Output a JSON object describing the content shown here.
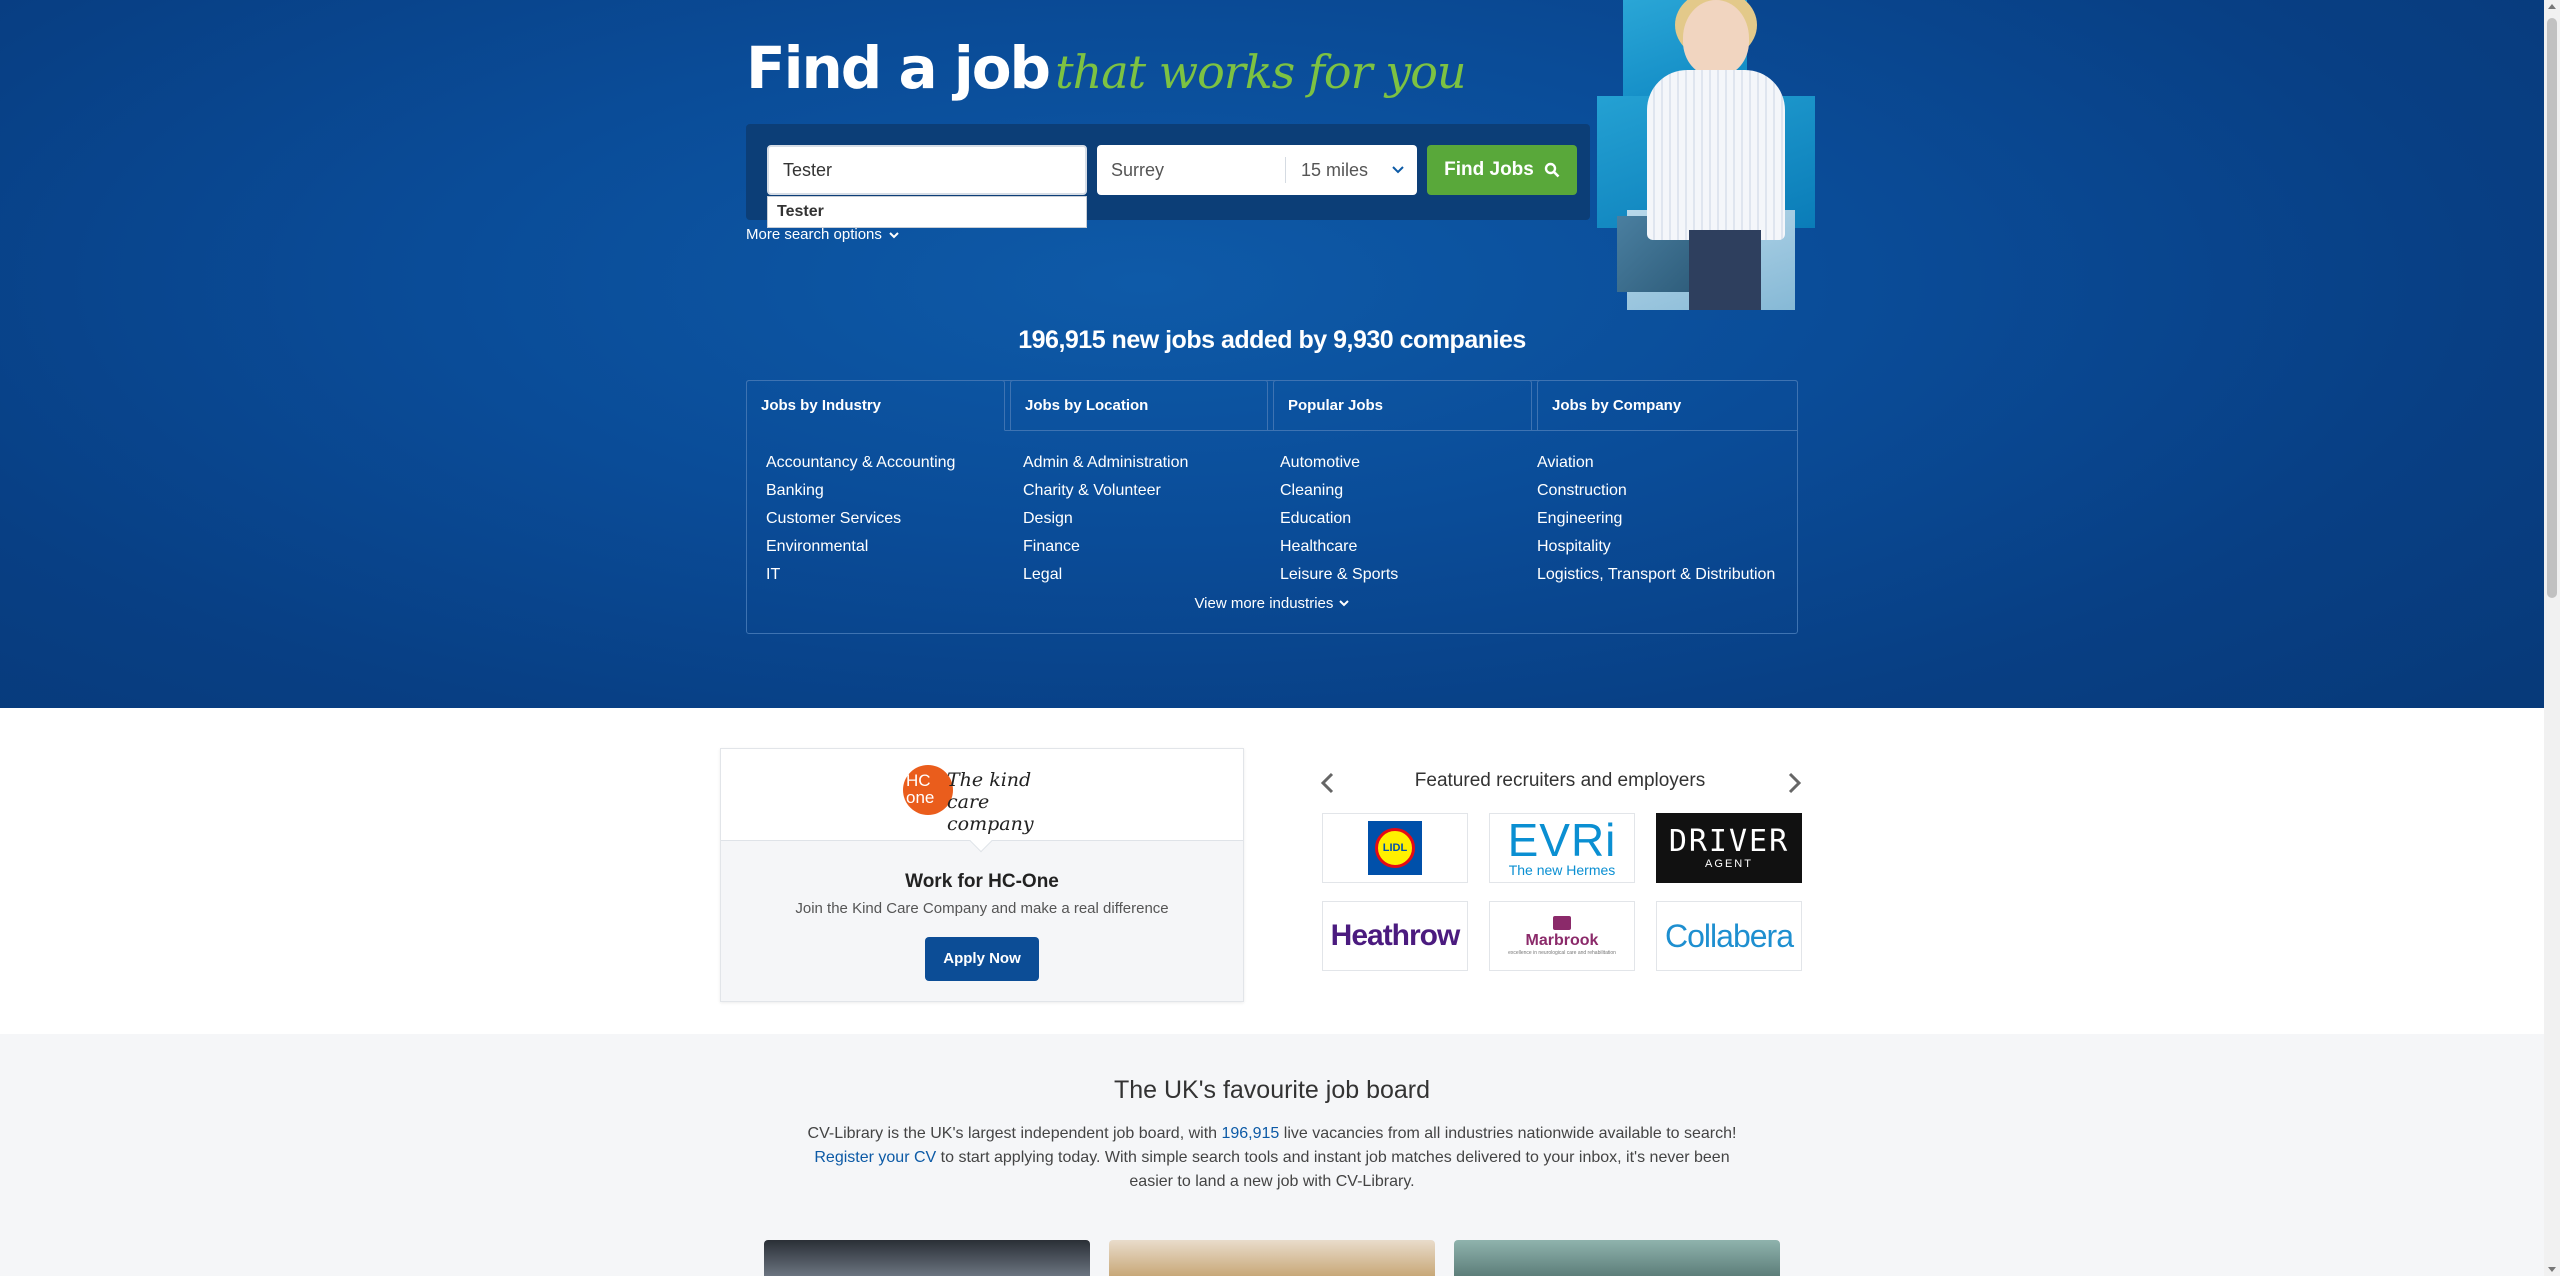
{
  "hero": {
    "title_main": "Find a job",
    "title_script": "that works for you",
    "search": {
      "keyword_value": "Tester",
      "suggestion": "Tester",
      "location_value": "Surrey",
      "distance": "15 miles",
      "find_label": "Find Jobs",
      "more_options": "More search options"
    },
    "stats": "196,915 new jobs added by 9,930 companies"
  },
  "categories": {
    "tabs": [
      "Jobs by Industry",
      "Jobs by Location",
      "Popular Jobs",
      "Jobs by Company"
    ],
    "columns": [
      [
        "Accountancy & Accounting",
        "Banking",
        "Customer Services",
        "Environmental",
        "IT"
      ],
      [
        "Admin & Administration",
        "Charity & Volunteer",
        "Design",
        "Finance",
        "Legal"
      ],
      [
        "Automotive",
        "Cleaning",
        "Education",
        "Healthcare",
        "Leisure & Sports"
      ],
      [
        "Aviation",
        "Construction",
        "Engineering",
        "Hospitality",
        "Logistics, Transport & Distribution"
      ]
    ],
    "view_more": "View more industries"
  },
  "promo": {
    "logo_circle": "HC one",
    "logo_text_1": "The kind",
    "logo_text_2": "care company",
    "title": "Work for HC-One",
    "description": "Join the Kind Care Company and make a real difference",
    "apply_label": "Apply Now"
  },
  "featured": {
    "title": "Featured recruiters and employers",
    "logos": {
      "lidl": "LIDL",
      "evri_main": "EVRi",
      "evri_sub": "The new Hermes",
      "driver_main": "DRIVER",
      "driver_sub": "AGENT",
      "heathrow": "Heathrow",
      "marbrook_main": "Marbrook",
      "marbrook_sub": "excellence in neurological care and rehabilitation",
      "collabera": "Collabera"
    }
  },
  "about": {
    "title": "The UK's favourite job board",
    "text_1": "CV-Library is the UK's largest independent job board, with ",
    "count_link": "196,915",
    "text_2": " live vacancies from all industries nationwide available to search! ",
    "register_link": "Register your CV",
    "text_3": " to start applying today. With simple search tools and instant job matches delivered to your inbox, it's never been easier to land a new job with CV-Library."
  },
  "colors": {
    "hero_blue": "#0a4c98",
    "find_green": "#59a83a",
    "script_green": "#7dc242",
    "apply_blue": "#0c4d96",
    "link_blue": "#0c5aa6",
    "hc_orange": "#ea5d1c"
  }
}
